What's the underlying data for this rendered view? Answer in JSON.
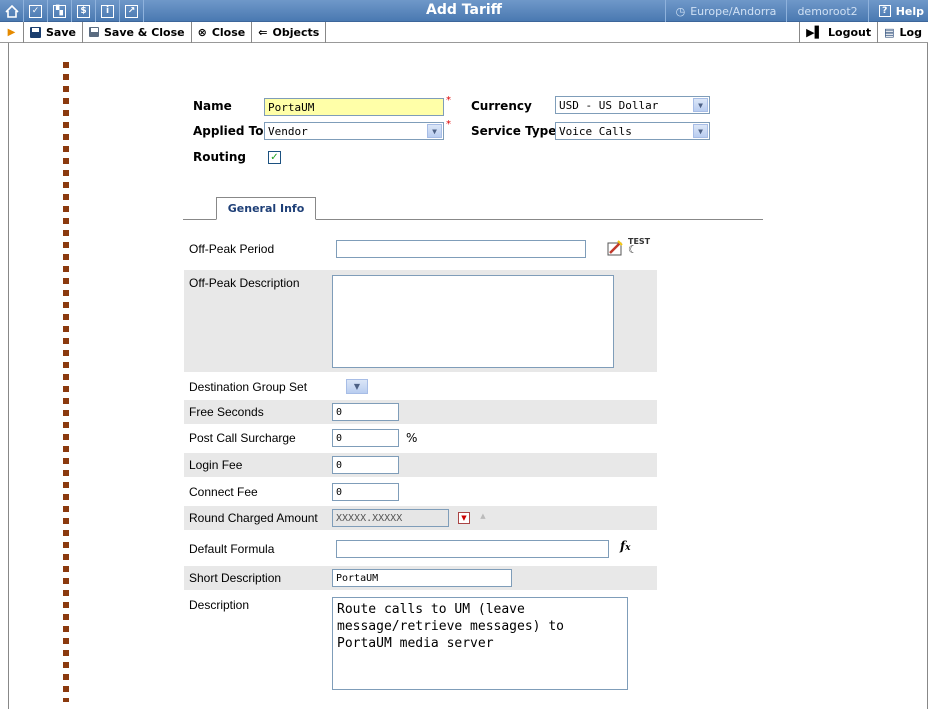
{
  "window": {
    "title": "Add Tariff",
    "timezone": "Europe/Andorra",
    "user": "demoroot2",
    "help": "Help"
  },
  "toolbar": {
    "save": "Save",
    "save_close": "Save & Close",
    "close": "Close",
    "objects": "Objects",
    "logout": "Logout",
    "log": "Log"
  },
  "header": {
    "name_label": "Name",
    "name_value": "PortaUM",
    "currency_label": "Currency",
    "currency_value": "USD - US Dollar",
    "applied_to_label": "Applied To",
    "applied_to_value": "Vendor",
    "service_type_label": "Service Type",
    "service_type_value": "Voice Calls",
    "routing_label": "Routing",
    "routing_checked": true
  },
  "tabs": [
    {
      "label": "General Info"
    }
  ],
  "general": {
    "off_peak_period_label": "Off-Peak Period",
    "off_peak_period_value": "",
    "off_peak_desc_label": "Off-Peak Description",
    "off_peak_desc_value": "",
    "dest_group_set_label": "Destination Group Set",
    "free_seconds_label": "Free Seconds",
    "free_seconds_value": "0",
    "post_call_label": "Post Call Surcharge",
    "post_call_value": "0",
    "post_call_unit": "%",
    "login_fee_label": "Login Fee",
    "login_fee_value": "0",
    "connect_fee_label": "Connect Fee",
    "connect_fee_value": "0",
    "round_label": "Round Charged Amount",
    "round_value": "XXXXX.XXXXX",
    "default_formula_label": "Default Formula",
    "default_formula_value": "",
    "short_desc_label": "Short Description",
    "short_desc_value": "PortaUM",
    "description_label": "Description",
    "description_value": "Route calls to UM (leave message/retrieve messages) to PortaUM media server"
  },
  "icons": {
    "home": "home-icon",
    "colors": {
      "titlebar": "#4a79b1",
      "tab_text": "#1e3f77",
      "dots": "#8b3a0e",
      "highlight": "#ffffa8"
    }
  }
}
